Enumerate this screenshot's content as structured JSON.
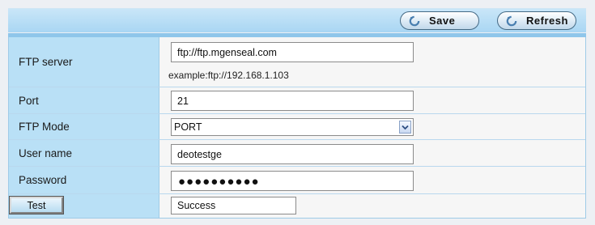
{
  "toolbar": {
    "save_label": "Save",
    "refresh_label": "Refresh"
  },
  "form": {
    "ftp_server": {
      "label": "FTP server",
      "value": "ftp://ftp.mgenseal.com",
      "hint": "example:ftp://192.168.1.103"
    },
    "port": {
      "label": "Port",
      "value": "21"
    },
    "ftp_mode": {
      "label": "FTP Mode",
      "value": "PORT"
    },
    "user_name": {
      "label": "User name",
      "value": "deotestge"
    },
    "password": {
      "label": "Password",
      "value": "●●●●●●●●●●"
    },
    "test": {
      "button_label": "Test",
      "result": "Success"
    }
  }
}
